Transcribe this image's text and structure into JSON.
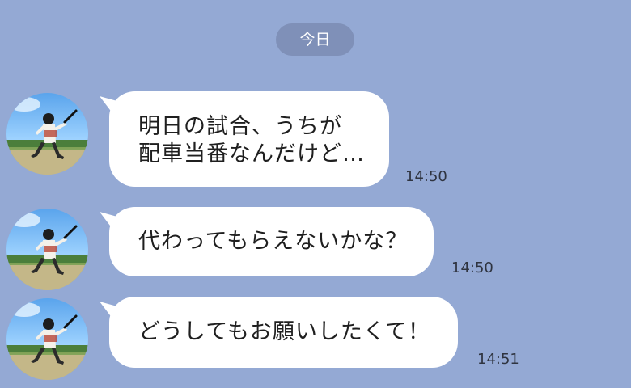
{
  "chat": {
    "date_label": "今日",
    "messages": [
      {
        "text_lines": [
          "明日の試合、うちが",
          "配車当番なんだけど…"
        ],
        "time": "14:50"
      },
      {
        "text_lines": [
          "代わってもらえないかな？"
        ],
        "time": "14:50"
      },
      {
        "text_lines": [
          "どうしてもお願いしたくて！"
        ],
        "time": "14:51"
      }
    ]
  },
  "colors": {
    "chat_background": "#94a9d4",
    "date_pill": "#7f90b8",
    "bubble": "#ffffff",
    "text": "#1f1f1f"
  }
}
